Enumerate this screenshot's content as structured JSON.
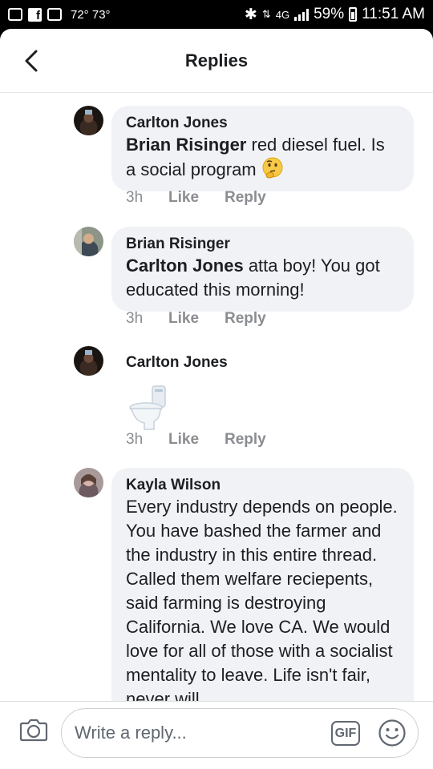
{
  "status_bar": {
    "temperature": "72° 73°",
    "network": "4G",
    "battery": "59%",
    "time": "11:51 AM"
  },
  "header": {
    "title": "Replies"
  },
  "replies": [
    {
      "author": "Carlton Jones",
      "mention": "Brian Risinger",
      "text": "  red diesel fuel. Is a social program",
      "emoji": "thinking-face-icon",
      "time": "3h",
      "like_label": "Like",
      "reply_label": "Reply"
    },
    {
      "author": "Brian Risinger",
      "mention": "Carlton Jones",
      "text": " atta boy! You got educated this morning!",
      "time": "3h",
      "like_label": "Like",
      "reply_label": "Reply"
    },
    {
      "author": "Carlton Jones",
      "sticker": "toilet-icon",
      "time": "3h",
      "like_label": "Like",
      "reply_label": "Reply"
    },
    {
      "author": "Kayla Wilson",
      "text": "Every industry depends on people. You have bashed the farmer and the industry in this entire thread. Called them welfare reciepents, said farming is destroying California. We love CA. We would love for all of those with a socialist mentality to leave. Life isn't fair, never will"
    }
  ],
  "composer": {
    "placeholder": "Write a reply...",
    "gif_label": "GIF"
  },
  "colors": {
    "bubble": "#f0f2f5",
    "meta_text": "#8a8d91",
    "primary_text": "#1c1e21"
  }
}
